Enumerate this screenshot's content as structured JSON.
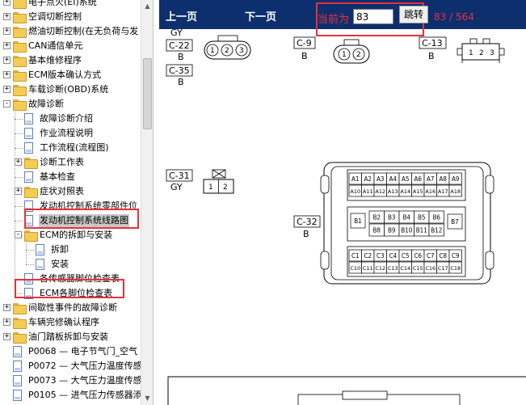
{
  "tree": {
    "items": [
      {
        "label": "电子点火(EI)系统",
        "type": "folder",
        "level": 0,
        "expander": "+"
      },
      {
        "label": "空调切断控制",
        "type": "folder",
        "level": 0,
        "expander": "+"
      },
      {
        "label": "燃油切断控制(在无负荷与发",
        "type": "folder",
        "level": 0,
        "expander": "+"
      },
      {
        "label": "CAN通信单元",
        "type": "folder",
        "level": 0,
        "expander": "+"
      },
      {
        "label": "基本维修程序",
        "type": "folder",
        "level": 0,
        "expander": "+"
      },
      {
        "label": "ECM版本确认方式",
        "type": "folder",
        "level": 0,
        "expander": "+"
      },
      {
        "label": "车载诊断(OBD)系统",
        "type": "folder",
        "level": 0,
        "expander": "+"
      },
      {
        "label": "故障诊断",
        "type": "folder",
        "level": 0,
        "expander": "-"
      },
      {
        "label": "故障诊断介绍",
        "type": "doc",
        "level": 1
      },
      {
        "label": "作业流程说明",
        "type": "doc",
        "level": 1
      },
      {
        "label": "工作流程(流程图)",
        "type": "doc",
        "level": 1
      },
      {
        "label": "诊断工作表",
        "type": "folder",
        "level": 1,
        "expander": "+"
      },
      {
        "label": "基本检查",
        "type": "doc",
        "level": 1
      },
      {
        "label": "症状对照表",
        "type": "folder",
        "level": 1,
        "expander": "+"
      },
      {
        "label": "发动机控制系统零部件位",
        "type": "doc",
        "level": 1
      },
      {
        "label": "发动机控制系统线路图",
        "type": "doc",
        "level": 1,
        "selected": true
      },
      {
        "label": "ECM的拆卸与安装",
        "type": "folder",
        "level": 1,
        "expander": "-"
      },
      {
        "label": "拆卸",
        "type": "doc",
        "level": 2
      },
      {
        "label": "安装",
        "type": "doc",
        "level": 2
      },
      {
        "label": "各传感器脚位检查表",
        "type": "doc",
        "level": 1
      },
      {
        "label": "ECM各脚位检查表",
        "type": "doc",
        "level": 1
      },
      {
        "label": "间歇性事件的故障诊断",
        "type": "folder",
        "level": 0,
        "expander": "+"
      },
      {
        "label": "车辆完修确认程序",
        "type": "folder",
        "level": 0,
        "expander": "+"
      },
      {
        "label": "油门踏板拆卸与安装",
        "type": "folder",
        "level": 0,
        "expander": "+"
      },
      {
        "label": "P0068 — 电子节气门_空气",
        "type": "doc",
        "level": 0
      },
      {
        "label": "P0072 — 大气压力温度传感",
        "type": "doc",
        "level": 0
      },
      {
        "label": "P0073 — 大气压力温度传感",
        "type": "doc",
        "level": 0
      },
      {
        "label": "P0105 — 进气压力传感器添",
        "type": "doc",
        "level": 0
      }
    ]
  },
  "toolbar": {
    "prev_label": "上一页",
    "next_label": "下一页",
    "page_label": "当前为",
    "page_value": "83",
    "jump_label": "跳转",
    "page_count": "83 / 564"
  },
  "diagram": {
    "connectors": [
      {
        "id": "C-22",
        "color": "GY",
        "pins": [
          "1",
          "2",
          "3"
        ]
      },
      {
        "id": "C-35",
        "color": "B"
      },
      {
        "id": "C-9",
        "color": "B",
        "pins": [
          "1",
          "2"
        ]
      },
      {
        "id": "C-13",
        "color": "B",
        "pins": [
          "1",
          "2",
          "3"
        ]
      },
      {
        "id": "C-31",
        "color": "GY",
        "pins": [
          "1",
          "2"
        ]
      },
      {
        "id": "C-32",
        "color": "B"
      }
    ],
    "ecm_rows": {
      "a_top": [
        "A1",
        "A2",
        "A3",
        "A4",
        "A5",
        "A6",
        "A7",
        "A8",
        "A9"
      ],
      "a_bottom": [
        "A10",
        "A11",
        "A12",
        "A13",
        "A14",
        "A15",
        "A16",
        "A17",
        "A18"
      ],
      "b_left": "B1",
      "b_top": [
        "B2",
        "B3",
        "B4",
        "B5",
        "B6"
      ],
      "b_bottom": [
        "B8",
        "B9",
        "B10",
        "B11",
        "B12"
      ],
      "b_right": "B7",
      "c_top": [
        "C1",
        "C2",
        "C3",
        "C4",
        "C5",
        "C6",
        "C7",
        "C8",
        "C9"
      ],
      "c_bottom": [
        "C10",
        "C11",
        "C12",
        "C13",
        "C14",
        "C15",
        "C16",
        "C17",
        "C18"
      ]
    }
  }
}
